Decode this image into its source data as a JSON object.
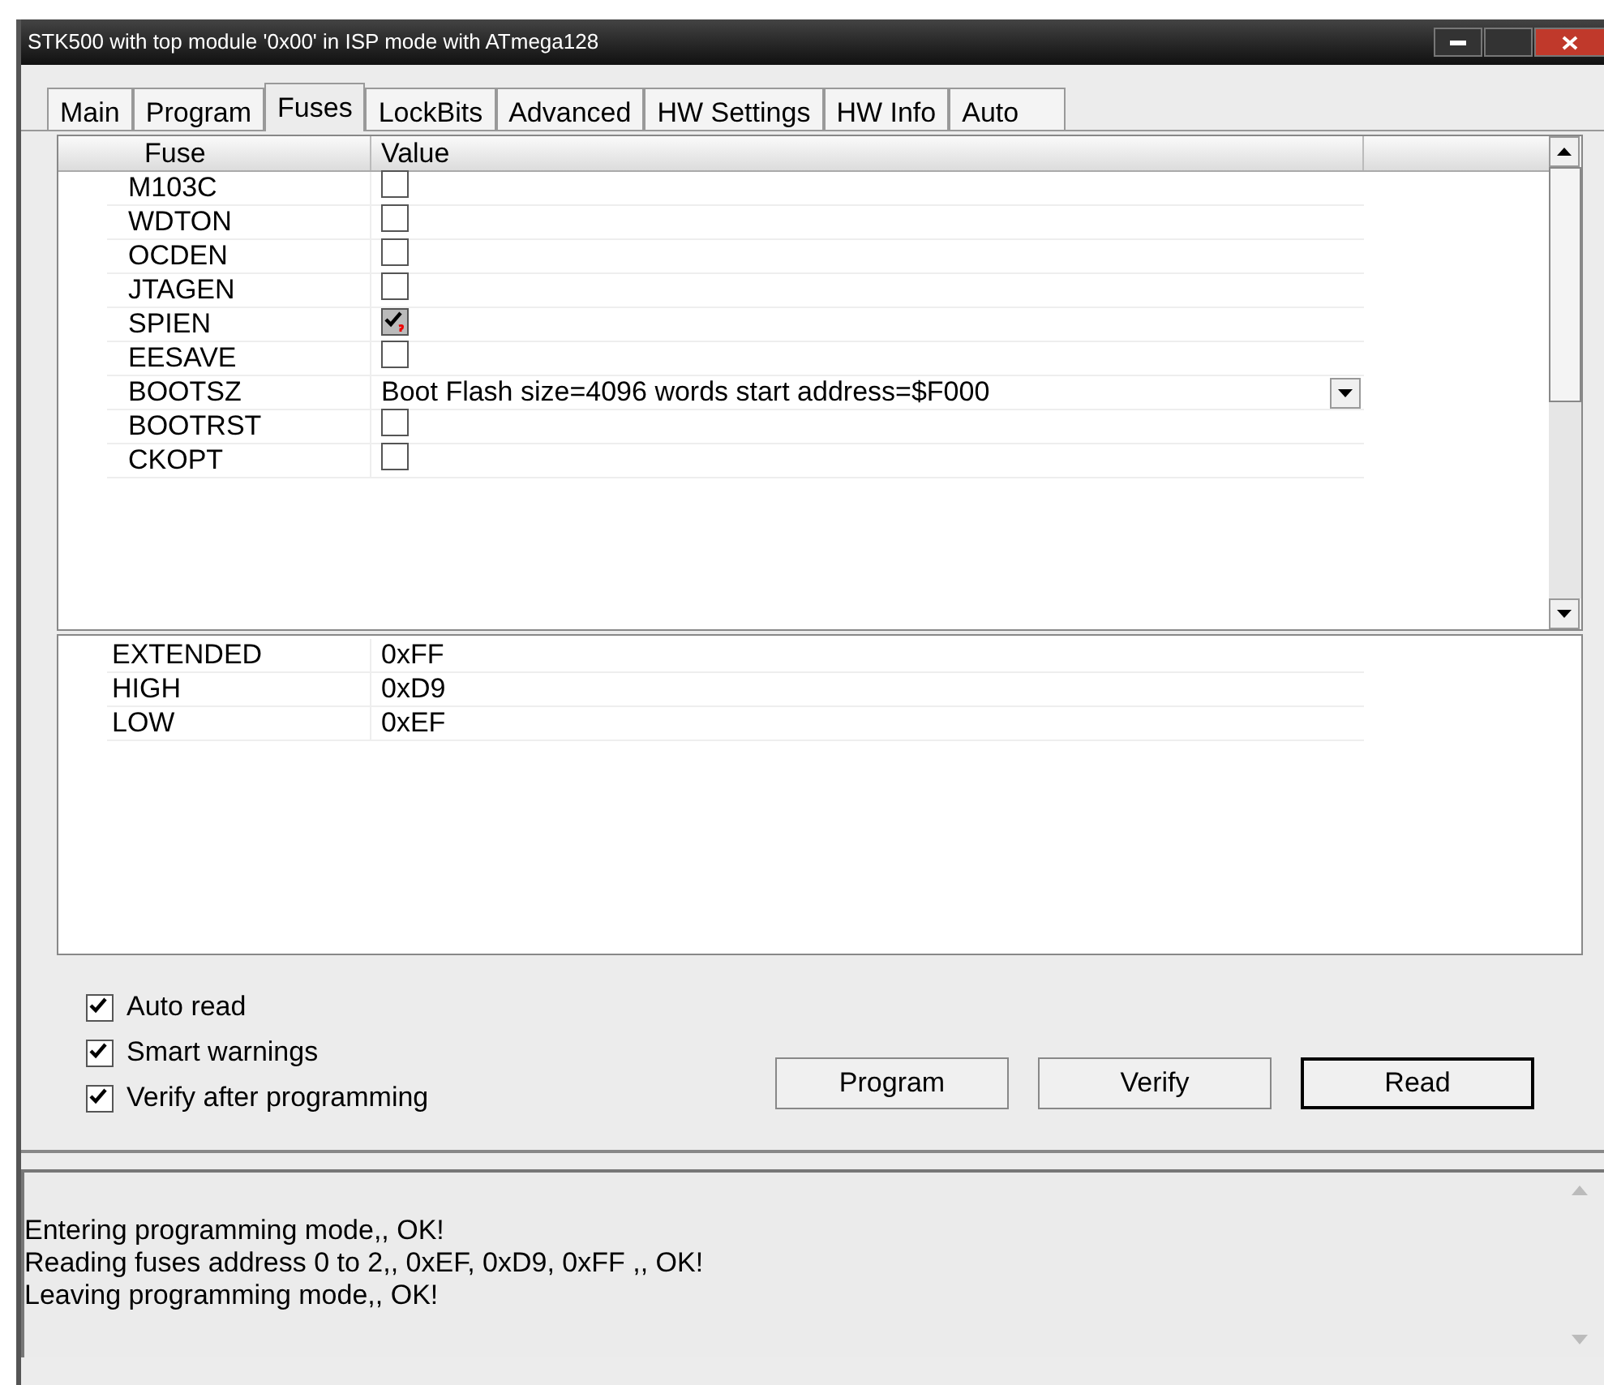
{
  "window": {
    "title": "STK500 with top module '0x00' in ISP mode with ATmega128"
  },
  "tabs": [
    {
      "label": "Main",
      "selected": false
    },
    {
      "label": "Program",
      "selected": false
    },
    {
      "label": "Fuses",
      "selected": true
    },
    {
      "label": "LockBits",
      "selected": false
    },
    {
      "label": "Advanced",
      "selected": false
    },
    {
      "label": "HW Settings",
      "selected": false
    },
    {
      "label": "HW Info",
      "selected": false
    },
    {
      "label": "Auto",
      "selected": false
    }
  ],
  "fuse_table": {
    "columns": [
      "Fuse",
      "Value"
    ],
    "rows": [
      {
        "name": "M103C",
        "kind": "checkbox",
        "checked": false
      },
      {
        "name": "WDTON",
        "kind": "checkbox",
        "checked": false
      },
      {
        "name": "OCDEN",
        "kind": "checkbox",
        "checked": false
      },
      {
        "name": "JTAGEN",
        "kind": "checkbox",
        "checked": false
      },
      {
        "name": "SPIEN",
        "kind": "checkbox",
        "checked": true
      },
      {
        "name": "EESAVE",
        "kind": "checkbox",
        "checked": false
      },
      {
        "name": "BOOTSZ",
        "kind": "select",
        "value": "Boot Flash size=4096 words start address=$F000"
      },
      {
        "name": "BOOTRST",
        "kind": "checkbox",
        "checked": false
      },
      {
        "name": "CKOPT",
        "kind": "checkbox",
        "checked": false
      }
    ]
  },
  "register_table": [
    {
      "name": "EXTENDED",
      "value": "0xFF"
    },
    {
      "name": "HIGH",
      "value": "0xD9"
    },
    {
      "name": "LOW",
      "value": "0xEF"
    }
  ],
  "options": [
    {
      "label": "Auto read",
      "checked": true
    },
    {
      "label": "Smart warnings",
      "checked": true
    },
    {
      "label": "Verify after programming",
      "checked": true
    }
  ],
  "buttons": [
    {
      "label": "Program",
      "default": false
    },
    {
      "label": "Verify",
      "default": false
    },
    {
      "label": "Read",
      "default": true
    }
  ],
  "log": [
    "Entering programming mode,, OK!",
    "Reading fuses address 0 to 2,, 0xEF, 0xD9, 0xFF ,, OK!",
    "Leaving programming mode,, OK!"
  ]
}
